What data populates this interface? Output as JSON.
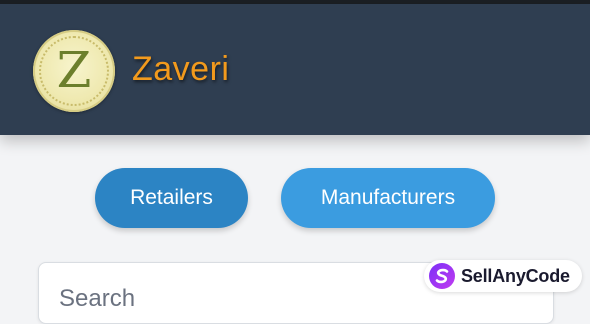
{
  "header": {
    "logo_letter": "Z",
    "title": "Zaveri"
  },
  "tabs": [
    {
      "label": "Retailers",
      "active": true
    },
    {
      "label": "Manufacturers",
      "active": false
    }
  ],
  "search": {
    "placeholder": "Search"
  },
  "watermark": {
    "text": "SellAnyCode"
  },
  "colors": {
    "header_bg": "#2f3e51",
    "brand_orange": "#f29a1d",
    "tab_active": "#2c84c4",
    "tab_inactive": "#3b9ce0",
    "page_bg": "#f3f4f6"
  }
}
